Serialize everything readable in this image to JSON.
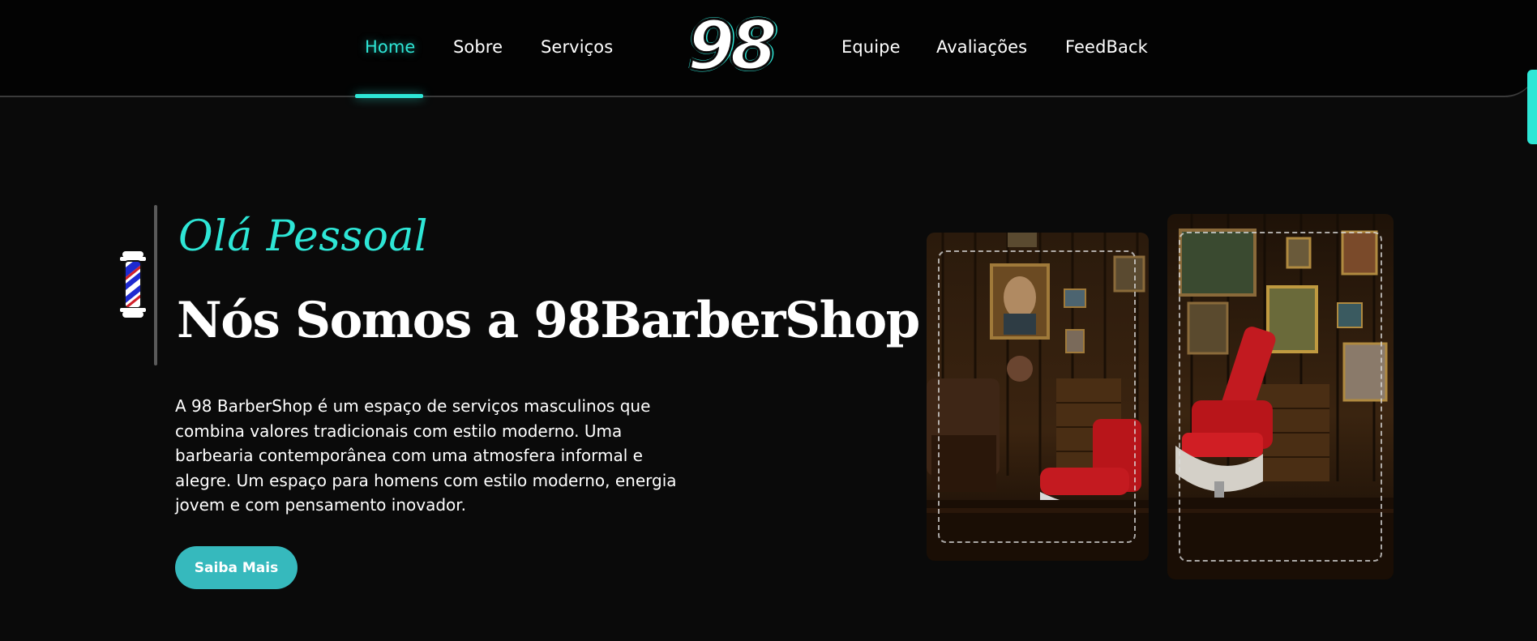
{
  "nav": {
    "left": [
      {
        "label": "Home",
        "active": true
      },
      {
        "label": "Sobre"
      },
      {
        "label": "Serviços"
      }
    ],
    "logo_text": "98",
    "right": [
      {
        "label": "Equipe"
      },
      {
        "label": "Avaliações"
      },
      {
        "label": "FeedBack"
      }
    ]
  },
  "hero": {
    "greeting": "Olá Pessoal",
    "headline": "Nós Somos a 98BarberShop",
    "description": "A 98 BarberShop é um espaço de serviços masculinos que combina valores tradicionais com estilo moderno. Uma barbearia contemporânea com uma atmosfera informal e alegre. Um espaço para homens com estilo moderno, energia jovem e com pensamento inovador.",
    "cta_label": "Saiba Mais",
    "pole_icon": "barber-pole-icon"
  },
  "colors": {
    "accent": "#2ee6d6",
    "button": "#36b9bd",
    "background": "#0a0a0a",
    "header": "#030303"
  }
}
